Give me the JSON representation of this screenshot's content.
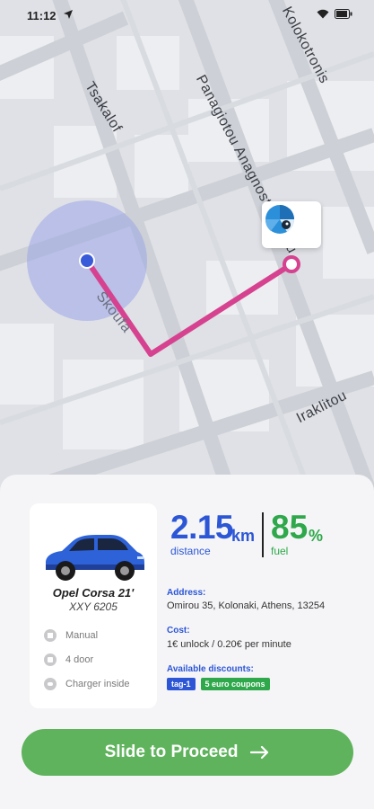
{
  "status_bar": {
    "time": "11:12",
    "icons": [
      "location-arrow-icon",
      "wifi-icon",
      "battery-icon"
    ]
  },
  "map": {
    "streets": {
      "tsakalof": "Tsakalof",
      "panagiotou": "Panagiotou Anagnostopoulou",
      "kolokotronis": "Kolokotronis",
      "skoufa": "Skoufa",
      "iraklitou": "Iraklitou"
    },
    "colors": {
      "route": "#d6428f",
      "user_dot": "#3a5bd9",
      "radius": "#9aa6e8"
    }
  },
  "car": {
    "name": "Opel Corsa 21'",
    "plate": "XXY 6205",
    "color": "#2d62d8",
    "features": [
      {
        "icon": "gearbox-icon",
        "label": "Manual"
      },
      {
        "icon": "door-icon",
        "label": "4 door"
      },
      {
        "icon": "charger-icon",
        "label": "Charger inside"
      }
    ]
  },
  "stats": {
    "distance_value": "2.15",
    "distance_unit": "km",
    "distance_label": "distance",
    "fuel_value": "85",
    "fuel_unit": "%",
    "fuel_label": "fuel"
  },
  "info": {
    "address_label": "Address:",
    "address_value": "Omirou 35, Kolonaki, Athens, 13254",
    "cost_label": "Cost:",
    "cost_value": "1€ unlock / 0.20€ per minute",
    "discounts_label": "Available discounts:",
    "discounts": [
      "tag-1",
      "5 euro coupons"
    ]
  },
  "action": {
    "slide_label": "Slide to Proceed"
  }
}
